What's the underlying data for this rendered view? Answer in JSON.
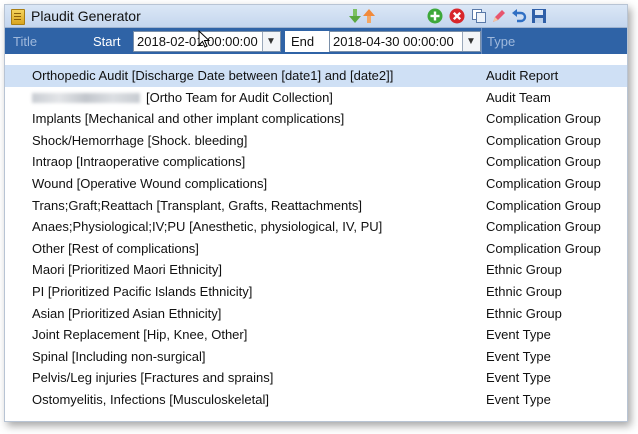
{
  "window": {
    "title": "Plaudit Generator"
  },
  "toolbar": {
    "icons": [
      "move-down-icon",
      "move-up-icon",
      "add-icon",
      "delete-icon",
      "copy-icon",
      "edit-icon",
      "undo-icon",
      "save-icon"
    ]
  },
  "filter": {
    "title_header": "Title",
    "start_label": "Start",
    "start_value": "2018-02-01 00:00:00",
    "end_label": "End",
    "end_value": "2018-04-30 00:00:00",
    "type_header": "Type"
  },
  "colors": {
    "header_blue": "#2f63a6",
    "selected_row": "#cfe0f5",
    "titlebar": "#dbe7f6"
  },
  "rows": [
    {
      "title": "Orthopedic Audit",
      "desc": "[Discharge Date between [date1] and [date2]]",
      "type": "Audit Report",
      "selected": true
    },
    {
      "title": "",
      "desc": "[Ortho Team for Audit Collection]",
      "type": "Audit Team",
      "redacted": true
    },
    {
      "title": "Implants",
      "desc": "[Mechanical and other implant complications]",
      "type": "Complication Group"
    },
    {
      "title": "Shock/Hemorrhage",
      "desc": "[Shock. bleeding]",
      "type": "Complication Group"
    },
    {
      "title": "Intraop",
      "desc": "[Intraoperative complications]",
      "type": "Complication Group"
    },
    {
      "title": "Wound",
      "desc": "[Operative Wound complications]",
      "type": "Complication Group"
    },
    {
      "title": "Trans;Graft;Reattach",
      "desc": "[Transplant, Grafts, Reattachments]",
      "type": "Complication Group"
    },
    {
      "title": "Anaes;Physiological;IV;PU",
      "desc": "[Anesthetic, physiological, IV, PU]",
      "type": "Complication Group"
    },
    {
      "title": "Other",
      "desc": "[Rest of complications]",
      "type": "Complication Group"
    },
    {
      "title": "Maori",
      "desc": "[Prioritized Maori Ethnicity]",
      "type": "Ethnic Group"
    },
    {
      "title": "PI",
      "desc": "[Prioritized Pacific Islands Ethnicity]",
      "type": "Ethnic Group"
    },
    {
      "title": "Asian",
      "desc": "[Prioritized Asian Ethnicity]",
      "type": "Ethnic Group"
    },
    {
      "title": "Joint Replacement",
      "desc": "[Hip, Knee, Other]",
      "type": "Event Type"
    },
    {
      "title": "Spinal",
      "desc": "[Including non-surgical]",
      "type": "Event Type"
    },
    {
      "title": "Pelvis/Leg injuries",
      "desc": "[Fractures and sprains]",
      "type": "Event Type"
    },
    {
      "title": "Ostomyelitis, Infections",
      "desc": "[Musculoskeletal]",
      "type": "Event Type"
    }
  ]
}
